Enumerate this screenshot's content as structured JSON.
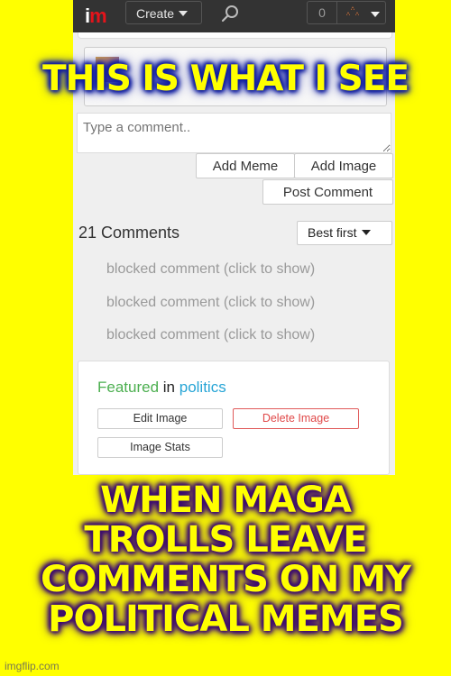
{
  "meme": {
    "top_caption": "THIS IS WHAT I SEE",
    "bottom_caption_lines": [
      "WHEN MAGA",
      "TROLLS LEAVE",
      "COMMENTS ON MY",
      "POLITICAL MEMES"
    ],
    "watermark": "imgflip.com",
    "background_color": "#ffff00"
  },
  "nav": {
    "logo_i": "i",
    "logo_m": "m",
    "create_label": "Create",
    "notification_count": "0",
    "search_icon": "search-icon",
    "user_icon": "user-avatar-icon"
  },
  "comment_form": {
    "placeholder": "Type a comment..",
    "value": "",
    "add_meme_label": "Add Meme",
    "add_image_label": "Add Image",
    "post_comment_label": "Post Comment"
  },
  "comments": {
    "count_label": "21 Comments",
    "sort_selected": "Best first",
    "blocked_items": [
      "blocked comment (click to show)",
      "blocked comment (click to show)",
      "blocked comment (click to show)"
    ]
  },
  "featured": {
    "featured_word": "Featured",
    "in_word": "in",
    "category": "politics",
    "edit_image_label": "Edit Image",
    "delete_image_label": "Delete Image",
    "image_stats_label": "Image Stats",
    "colors": {
      "featured": "#4caf50",
      "category": "#27a5d6",
      "delete": "#e04848"
    }
  }
}
